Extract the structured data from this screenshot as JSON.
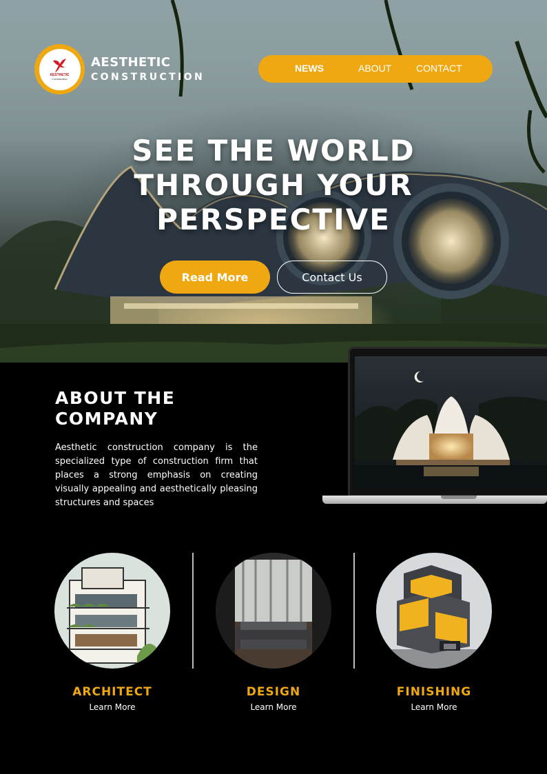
{
  "brand": {
    "name_line1": "AESTHETIC",
    "name_line2": "CONSTRUCTION",
    "logo_text_1": "AESTHETIC",
    "logo_text_2": "Construction"
  },
  "nav": {
    "items": [
      "NEWS",
      "ABOUT",
      "CONTACT"
    ]
  },
  "hero": {
    "headline_1": "SEE THE WORLD",
    "headline_2": "THROUGH YOUR",
    "headline_3": "PERSPECTIVE",
    "primary_button": "Read More",
    "secondary_button": "Contact Us"
  },
  "about": {
    "title_1": "ABOUT THE",
    "title_2": "COMPANY",
    "body": "Aesthetic construction company is the specialized type of construction firm that places a strong emphasis on creating visually appealing and aesthetically pleasing structures and spaces"
  },
  "services": [
    {
      "title": "ARCHITECT",
      "link": "Learn More",
      "image": "modern-building-sketch"
    },
    {
      "title": "DESIGN",
      "link": "Learn More",
      "image": "bedroom-interior"
    },
    {
      "title": "FINISHING",
      "link": "Learn More",
      "image": "futuristic-yellow-house"
    }
  ],
  "colors": {
    "accent": "#f0a812",
    "background": "#000000",
    "text": "#ffffff"
  }
}
